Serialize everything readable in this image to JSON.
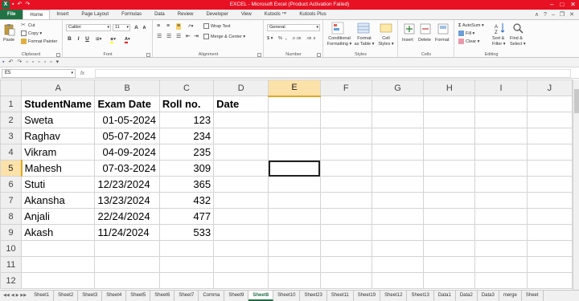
{
  "titlebar": {
    "app_icon": "X",
    "title": "EXCEL - Microsoft Excel (Product Activation Failed)",
    "qat_icons": [
      "save-icon",
      "undo-icon",
      "redo-icon"
    ]
  },
  "ribbon_tabs": [
    "File",
    "Home",
    "Insert",
    "Page Layout",
    "Formulas",
    "Data",
    "Review",
    "Developer",
    "View",
    "Kutools ™",
    "Kutools Plus"
  ],
  "active_tab": "Home",
  "ribbon": {
    "clipboard": {
      "label": "Clipboard",
      "paste": "Paste",
      "cut": "Cut",
      "copy": "Copy ▾",
      "format_painter": "Format Painter"
    },
    "font": {
      "label": "Font",
      "name": "Calibri",
      "size": "11",
      "grow": "A",
      "shrink": "A",
      "bold": "B",
      "italic": "I",
      "underline": "U"
    },
    "alignment": {
      "label": "Alignment",
      "wrap_text": "Wrap Text",
      "merge_center": "Merge & Center ▾"
    },
    "number": {
      "label": "Number",
      "format": "General",
      "currency": "$ ▾",
      "percent": "%",
      "comma": ",",
      "inc_decimal": ".0 .00",
      "dec_decimal": ".00 .0"
    },
    "styles": {
      "label": "Styles",
      "conditional": "Conditional",
      "conditional2": "Formatting ▾",
      "format_table": "Format",
      "format_table2": "as Table ▾",
      "cell_styles": "Cell",
      "cell_styles2": "Styles ▾"
    },
    "cells": {
      "label": "Cells",
      "insert": "Insert",
      "delete": "Delete",
      "format": "Format"
    },
    "editing": {
      "label": "Editing",
      "autosum": "AutoSum ▾",
      "fill": "Fill ▾",
      "clear": "Clear ▾",
      "sort_filter": "Sort &",
      "sort_filter2": "Filter ▾",
      "find_select": "Find &",
      "find_select2": "Select ▾"
    }
  },
  "formula_bar": {
    "name_box": "E5",
    "fx": "fx",
    "content": ""
  },
  "columns": [
    "A",
    "B",
    "C",
    "D",
    "E",
    "F",
    "G",
    "H",
    "I",
    "J"
  ],
  "selected_column": "E",
  "selected_row": 5,
  "rows": [
    {
      "n": "1",
      "cells": [
        "StudentName",
        "Exam Date",
        "Roll no.",
        "Date",
        "",
        "",
        "",
        "",
        "",
        ""
      ]
    },
    {
      "n": "2",
      "cells": [
        "Sweta",
        "01-05-2024",
        "123",
        "",
        "",
        "",
        "",
        "",
        "",
        ""
      ]
    },
    {
      "n": "3",
      "cells": [
        "Raghav",
        "05-07-2024",
        "234",
        "",
        "",
        "",
        "",
        "",
        "",
        ""
      ]
    },
    {
      "n": "4",
      "cells": [
        "Vikram",
        "04-09-2024",
        "235",
        "",
        "",
        "",
        "",
        "",
        "",
        ""
      ]
    },
    {
      "n": "5",
      "cells": [
        "Mahesh",
        "07-03-2024",
        "309",
        "",
        "",
        "",
        "",
        "",
        "",
        ""
      ]
    },
    {
      "n": "6",
      "cells": [
        "Stuti",
        "12/23/2024",
        "365",
        "",
        "",
        "",
        "",
        "",
        "",
        ""
      ]
    },
    {
      "n": "7",
      "cells": [
        "Akansha",
        "13/23/2024",
        "432",
        "",
        "",
        "",
        "",
        "",
        "",
        ""
      ]
    },
    {
      "n": "8",
      "cells": [
        "Anjali",
        "22/24/2024",
        "477",
        "",
        "",
        "",
        "",
        "",
        "",
        ""
      ]
    },
    {
      "n": "9",
      "cells": [
        "Akash",
        "11/24/2024",
        "533",
        "",
        "",
        "",
        "",
        "",
        "",
        ""
      ]
    },
    {
      "n": "10",
      "cells": [
        "",
        "",
        "",
        "",
        "",
        "",
        "",
        "",
        "",
        ""
      ]
    },
    {
      "n": "11",
      "cells": [
        "",
        "",
        "",
        "",
        "",
        "",
        "",
        "",
        "",
        ""
      ]
    },
    {
      "n": "12",
      "cells": [
        "",
        "",
        "",
        "",
        "",
        "",
        "",
        "",
        "",
        ""
      ]
    }
  ],
  "sheet_tabs": [
    "Sheet1",
    "Sheet2",
    "Sheet3",
    "Sheet4",
    "Sheet5",
    "Sheet6",
    "Sheet7",
    "Comma",
    "Sheet9",
    "Sheet8",
    "Sheet10",
    "Sheet23",
    "Sheet11",
    "Sheet19",
    "Sheet12",
    "Sheet13",
    "Data1",
    "Data2",
    "Data3",
    "merge",
    "Sheet"
  ],
  "active_sheet": "Sheet8",
  "colors": {
    "accent": "#217346",
    "titlebar": "#e81123",
    "selection_header": "#fce2a9"
  }
}
